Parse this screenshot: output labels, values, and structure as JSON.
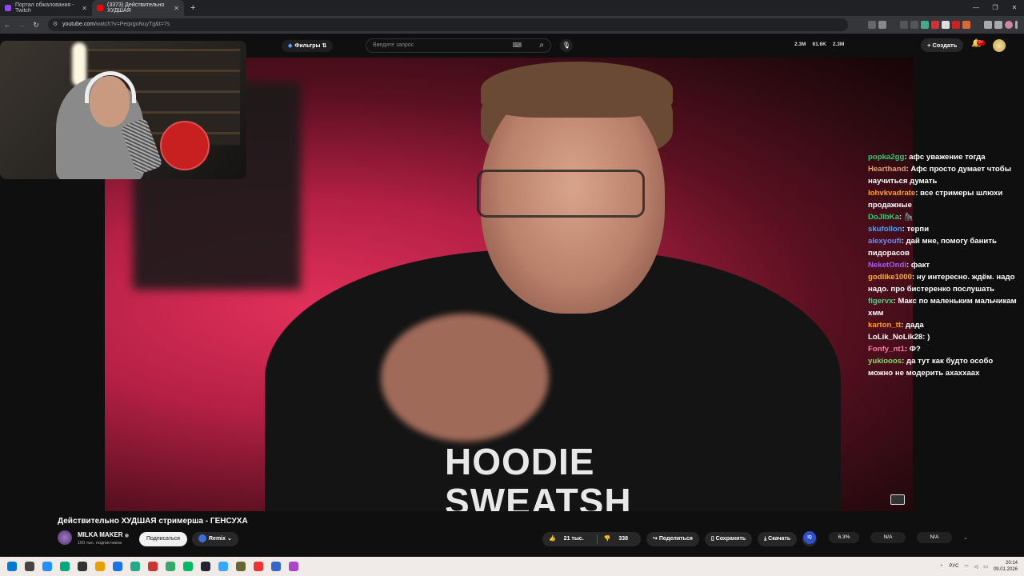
{
  "browser": {
    "tabs": [
      {
        "title": "Портал обжалования - Twitch",
        "color": "#9146ff",
        "active": false
      },
      {
        "title": "(3373) Действительно ХУДШАЯ",
        "color": "#ff0000",
        "active": true
      }
    ],
    "url_host": "youtube.com",
    "url_path": "/watch?v=PeqxgoNuyTg&t=7s",
    "window_controls": [
      "—",
      "❐",
      "✕"
    ]
  },
  "youtube": {
    "filter_label": "Фильтры",
    "search_placeholder": "Введите запрос",
    "header_stats": [
      "2.3M",
      "61.6K",
      "2.3M"
    ],
    "create_label": "Создать",
    "notif_badge": "9+",
    "video_title": "Действительно ХУДШАЯ стримерша - ГЕНСУХА",
    "channel_name": "MILKA MAKER",
    "channel_verified": "◉",
    "subscribers": "160 тыс. подписчиков",
    "subscribe_label": "Подписаться",
    "remix_label": "Remix",
    "likes": "21 тыс.",
    "dislikes": "338",
    "share_label": "Поделиться",
    "save_label": "Сохранить",
    "download_label": "Скачать",
    "more_label": "···",
    "ext_logo": "IQ",
    "ext_value_1": "6.3%",
    "ext_value_2": "N/A",
    "ext_value_3": "N/A",
    "hoodie_text_line1": "HOODIE",
    "hoodie_text_line2": "SWEATSH"
  },
  "chat": [
    {
      "user": "popka2gg",
      "color": "#2ecc71",
      "text": "афс уважение тогда"
    },
    {
      "user": "Hearthand",
      "color": "#e8a070",
      "text": "Афс просто думает чтобы научиться думать"
    },
    {
      "user": "lohvkvadrate",
      "color": "#ff9f1a",
      "text": "все стримеры шлюхи продажные"
    },
    {
      "user": "DoJIbKa",
      "color": "#2ecc71",
      "text": "🦍"
    },
    {
      "user": "skufollon",
      "color": "#4aa3ff",
      "text": "терпи"
    },
    {
      "user": "alexyoufi",
      "color": "#6c8cff",
      "text": "дай мне, помогу банить пидорасов"
    },
    {
      "user": "NeketOndi",
      "color": "#a35cff",
      "text": "факт"
    },
    {
      "user": "godlike1000",
      "color": "#ffb03a",
      "text": "ну интересно. ждём. надо надо. про бистеренко послушать"
    },
    {
      "user": "figervx",
      "color": "#3ddc84",
      "text": "Макс по маленьким мальчикам хмм"
    },
    {
      "user": "karton_tt",
      "color": "#ff9f1a",
      "text": "дада"
    },
    {
      "user": "LoLik_NoLik28",
      "color": "#ffffff",
      "text": ")"
    },
    {
      "user": "Fonfy_nt1",
      "color": "#ff7aa8",
      "text": "Ф?"
    },
    {
      "user": "yukiooos",
      "color": "#7ee06a",
      "text": "да тут как будто особо можно не модерить ахаххаах"
    }
  ],
  "taskbar": {
    "icons": [
      "#0078d4",
      "#444",
      "#1e90ff",
      "#0a7",
      "#333",
      "#e8a000",
      "#1a73e8",
      "#2a8",
      "#c33",
      "#3a6",
      "#0b6",
      "#223",
      "#3af",
      "#663",
      "#e33",
      "#36c",
      "#a4c"
    ],
    "lang": "РУС",
    "time": "20:14",
    "date": "09.01.2026"
  }
}
